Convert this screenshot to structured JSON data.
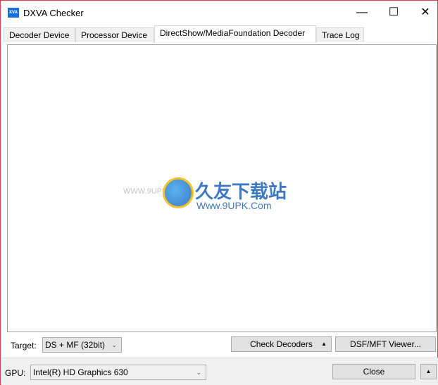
{
  "window": {
    "title": "DXVA Checker",
    "icon_text": "XVA",
    "minimize_glyph": "—",
    "maximize_glyph": "☐",
    "close_glyph": "✕"
  },
  "tabs": [
    {
      "label": "Decoder Device"
    },
    {
      "label": "Processor Device"
    },
    {
      "label": "DirectShow/MediaFoundation Decoder",
      "active": true
    },
    {
      "label": "Trace Log"
    }
  ],
  "watermark": {
    "brand": "久友下载站",
    "url": "Www.9UPK.Com",
    "faint": "WWW.9UPK.COM"
  },
  "controls": {
    "target_label": "Target:",
    "target_value": "DS + MF (32bit)",
    "check_decoders": "Check Decoders",
    "check_arrow": "▲",
    "viewer": "DSF/MFT Viewer..."
  },
  "footer": {
    "gpu_label": "GPU:",
    "gpu_value": "Intel(R) HD Graphics 630",
    "close": "Close",
    "expand": "▲"
  },
  "colors": {
    "accent": "#1a6fe0",
    "border": "#e04050"
  }
}
